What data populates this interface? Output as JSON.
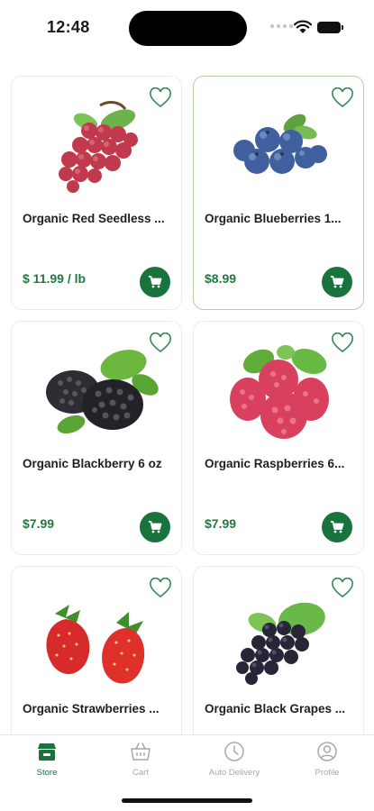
{
  "status_bar": {
    "time": "12:48"
  },
  "products": [
    {
      "name": "Organic Red Seedless ...",
      "price": "$ 11.99 / lb",
      "image_icon": "red-grapes-image",
      "favorite": false
    },
    {
      "name": "Organic Blueberries 1...",
      "price": "$8.99",
      "image_icon": "blueberries-image",
      "favorite": false
    },
    {
      "name": "Organic Blackberry 6 oz",
      "price": "$7.99",
      "image_icon": "blackberries-image",
      "favorite": false
    },
    {
      "name": "Organic Raspberries 6...",
      "price": "$7.99",
      "image_icon": "raspberries-image",
      "favorite": false
    },
    {
      "name": "Organic Strawberries ...",
      "price": "",
      "image_icon": "strawberries-image",
      "favorite": false
    },
    {
      "name": "Organic Black Grapes ...",
      "price": "",
      "image_icon": "black-grapes-image",
      "favorite": false
    }
  ],
  "tabs": [
    {
      "label": "Store",
      "icon": "store-icon",
      "active": true
    },
    {
      "label": "Cart",
      "icon": "basket-icon",
      "active": false
    },
    {
      "label": "Auto Delivery",
      "icon": "clock-icon",
      "active": false
    },
    {
      "label": "Profile",
      "icon": "profile-icon",
      "active": false
    }
  ],
  "colors": {
    "accent": "#18733d",
    "price": "#1f7a3c",
    "heart": "#2f8a4e",
    "inactive_tab": "#a8a8a8"
  }
}
